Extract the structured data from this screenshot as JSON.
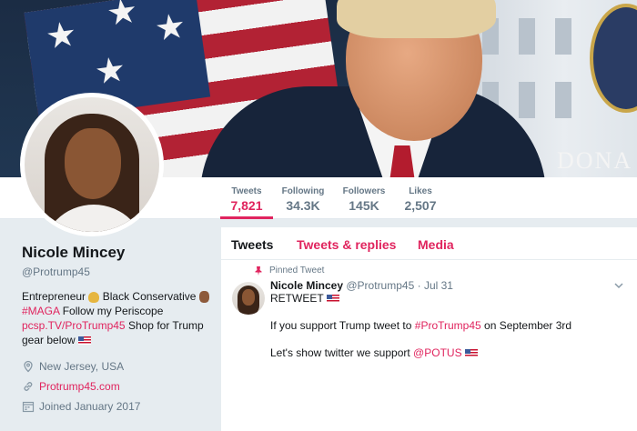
{
  "stats": [
    {
      "label": "Tweets",
      "value": "7,821",
      "active": true
    },
    {
      "label": "Following",
      "value": "34.3K",
      "active": false
    },
    {
      "label": "Followers",
      "value": "145K",
      "active": false
    },
    {
      "label": "Likes",
      "value": "2,507",
      "active": false
    }
  ],
  "banner": {
    "text": "DONA"
  },
  "profile": {
    "name": "Nicole Mincey",
    "handle": "@Protrump45",
    "bio": {
      "part1": "Entrepreneur",
      "part2": "Black Conservative",
      "hashtag": "#MAGA",
      "part3": "Follow my Periscope",
      "periscope_link": "pcsp.TV/ProTrump45",
      "part4": "Shop for Trump gear below"
    },
    "location": "New Jersey, USA",
    "website": "Protrump45.com",
    "joined": "Joined January 2017"
  },
  "tabs": [
    {
      "label": "Tweets",
      "active": true
    },
    {
      "label": "Tweets & replies",
      "active": false
    },
    {
      "label": "Media",
      "active": false
    }
  ],
  "tweet": {
    "pinned_label": "Pinned Tweet",
    "author_name": "Nicole Mincey",
    "author_handle": "@Protrump45",
    "separator": "·",
    "date": "Jul 31",
    "line1": "RETWEET",
    "line2_prefix": "If you support Trump tweet to",
    "line2_hashtag": "#ProTrump45",
    "line2_suffix": "on September 3rd",
    "line3_prefix": "Let's show twitter we support",
    "line3_mention": "@POTUS"
  },
  "colors": {
    "accent": "#e0245e",
    "secondary_text": "#657786",
    "primary_text": "#14171a",
    "page_bg": "#e6ecf0"
  },
  "icons": [
    "location-icon",
    "link-icon",
    "calendar-icon",
    "pin-icon",
    "chevron-down-icon",
    "us-flag-icon",
    "money-bag-icon",
    "ok-hand-icon"
  ]
}
